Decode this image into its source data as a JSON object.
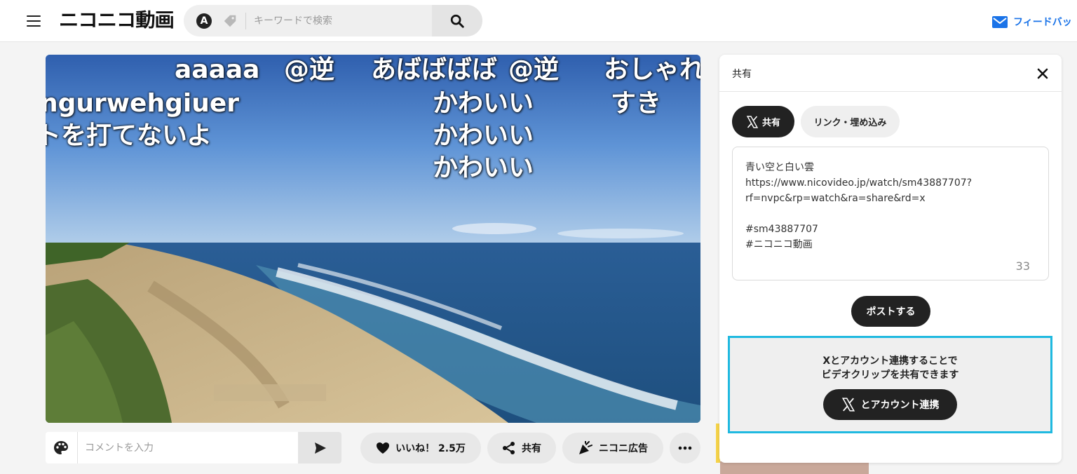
{
  "header": {
    "logo_text": "ニコニコ動画",
    "search": {
      "placeholder": "キーワードで検索",
      "value": "",
      "mode_icon": "autocomplete-a-icon",
      "tag_icon": "tag-icon",
      "submit_icon": "search-icon"
    },
    "feedback_label": "フィードバッ"
  },
  "video": {
    "comments": [
      "aaaaa",
      "@逆",
      "あばばばば",
      "@逆",
      "おしゃれ",
      "ngurwehgiuer",
      "すき",
      "トを打てないよ",
      "かわいい",
      "かわいい",
      "かわいい"
    ]
  },
  "comment_bar": {
    "input_placeholder": "コメントを入力",
    "input_value": "",
    "palette_icon": "palette-icon",
    "send_icon": "send-icon"
  },
  "actions": {
    "like_label": "いいね！ 2.5万",
    "share_label": "共有",
    "ad_label": "ニコニ広告",
    "more_icon": "more-icon"
  },
  "share_panel": {
    "title": "共有",
    "tabs": [
      {
        "label": "共有",
        "icon": "x-logo-icon",
        "active": true
      },
      {
        "label": "リンク・埋め込み",
        "active": false
      }
    ],
    "text_lines": [
      "青い空と白い雲",
      "https://www.nicovideo.jp/watch/sm43887707?",
      "rf=nvpc&rp=watch&ra=share&rd=x",
      "",
      "#sm43887707",
      "#ニコニコ動画"
    ],
    "char_count": "33",
    "post_label": "ポストする",
    "connect_message_line1": "Xとアカウント連携することで",
    "connect_message_line2": "ビデオクリップを共有できます",
    "connect_button_label": "とアカウント連携"
  },
  "colors": {
    "accent_blue": "#1a73e8",
    "highlight_border": "#1fb9e0",
    "dark_button": "#222222"
  }
}
